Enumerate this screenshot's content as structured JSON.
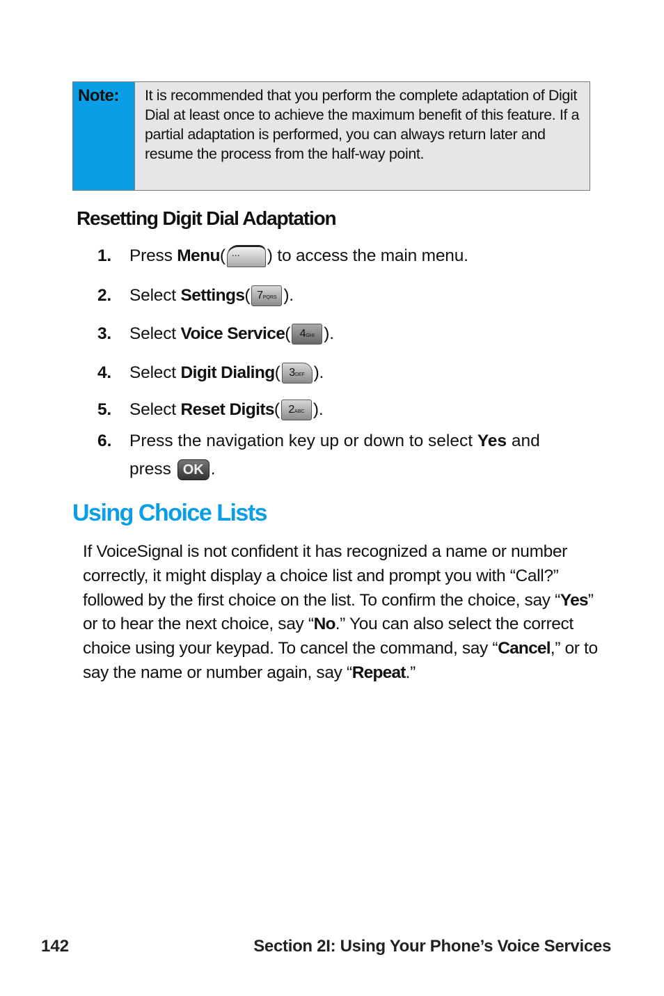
{
  "note": {
    "label": "Note:",
    "text": "It is recommended that you perform the complete adaptation of Digit Dial at least once to achieve the maximum benefit of this feature. If a partial adaptation is performed, you can always return later and resume the process from the half-way point.",
    "label_bg_color": "#0a9ee6",
    "box_bg_color": "#e6e6e6"
  },
  "subheading": "Resetting Digit Dial Adaptation",
  "steps": [
    {
      "num": "1.",
      "pre": "Press ",
      "bold": "Menu",
      "open": " (",
      "key_icon": "menu-softkey-icon",
      "key_label": "⋯",
      "post": ") to access the main menu."
    },
    {
      "num": "2.",
      "pre": "Select ",
      "bold": "Settings",
      "open": " (",
      "key_icon": "key-7-pqrs-icon",
      "key_digit": "7",
      "key_letters": "PQRS",
      "post": ")."
    },
    {
      "num": "3.",
      "pre": "Select ",
      "bold": "Voice Service",
      "open": " (",
      "key_icon": "key-4-ghi-icon",
      "key_digit": "4",
      "key_letters": "GHI",
      "post": ")."
    },
    {
      "num": "4.",
      "pre": "Select ",
      "bold": "Digit Dialing",
      "open": " (",
      "key_icon": "key-3-def-icon",
      "key_digit": "3",
      "key_letters": "DEF",
      "post": ")."
    },
    {
      "num": "5.",
      "pre": "Select ",
      "bold": "Reset Digits",
      "open": " (",
      "key_icon": "key-2-abc-icon",
      "key_digit": "2",
      "key_letters": "ABC",
      "post": ")."
    },
    {
      "num": "6.",
      "pre": "Press the navigation key up or down to select ",
      "bold": "Yes",
      "post": " and",
      "line2_pre": "press ",
      "key_icon": "ok-key-icon",
      "key_label": "OK",
      "line2_post": "."
    }
  ],
  "section": {
    "heading": "Using Choice Lists",
    "heading_color": "#0a9ee6",
    "paragraph": {
      "t1": "If VoiceSignal is not confident it has recognized a name or number correctly, it might display a choice list and prompt you with “Call?” followed by the first choice on the list. To confirm the choice, say “",
      "b1": "Yes",
      "t2": "” or to hear the next choice, say “",
      "b2": "No",
      "t3": ".” You can also select the correct choice using your keypad. To cancel the command, say “",
      "b3": "Cancel",
      "t4": ",” or to say the name or number again, say “",
      "b4": "Repeat",
      "t5": ".”"
    }
  },
  "footer": {
    "page_number": "142",
    "section_title": "Section 2I: Using Your Phone’s Voice Services"
  }
}
